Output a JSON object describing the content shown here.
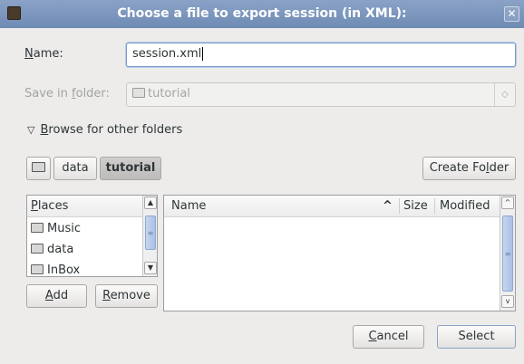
{
  "window": {
    "title": "Choose a file to export session (in XML):",
    "close_glyph": "✕"
  },
  "name_field": {
    "label_mnemonic": "N",
    "label_rest": "ame:",
    "value": "session.xml"
  },
  "save_in": {
    "label_prefix": "Save in ",
    "label_mnemonic": "f",
    "label_rest": "older:",
    "value": "tutorial",
    "arrow_glyph": "◇"
  },
  "browse": {
    "expander_glyph": "▽",
    "label_mnemonic": "B",
    "label_rest": "rowse for other folders"
  },
  "path_bar": {
    "items": [
      {
        "label": "data"
      },
      {
        "label": "tutorial"
      }
    ]
  },
  "create_folder": {
    "label_prefix": "Create Fo",
    "label_mnemonic": "l",
    "label_rest": "der"
  },
  "places": {
    "header_mnemonic": "P",
    "header_rest": "laces",
    "items": [
      {
        "label": "Music"
      },
      {
        "label": "data"
      },
      {
        "label": "InBox"
      }
    ]
  },
  "places_buttons": {
    "add_mnemonic": "A",
    "add_rest": "dd",
    "remove_mnemonic": "R",
    "remove_rest": "emove"
  },
  "files": {
    "columns": {
      "name": "Name",
      "size": "Size",
      "modified": "Modified"
    },
    "sort_glyph": "^"
  },
  "actions": {
    "cancel_mnemonic": "C",
    "cancel_rest": "ancel",
    "select": "Select"
  },
  "colors": {
    "titlebar": "#7b95bd",
    "window_bg": "#edeceb",
    "focus": "#7a9bc9"
  }
}
